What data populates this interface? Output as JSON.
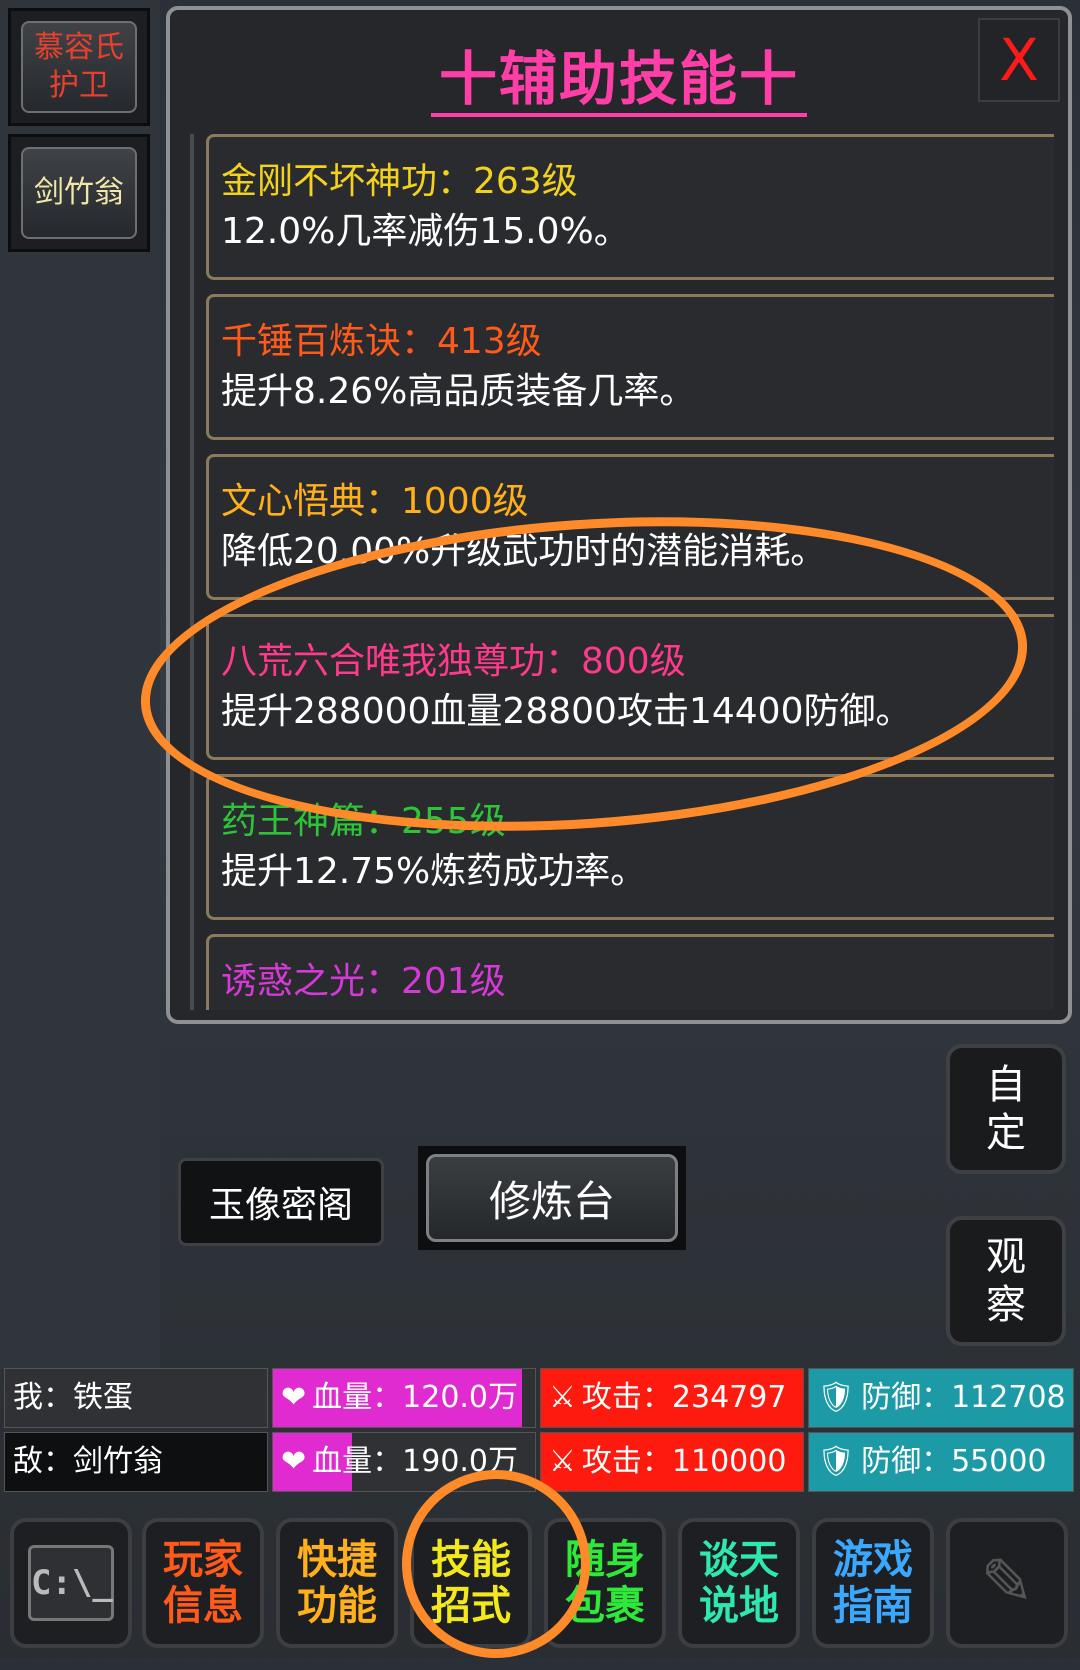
{
  "sidebar": {
    "tabs": [
      {
        "label": "慕容氏护卫"
      },
      {
        "label": "剑竹翁"
      }
    ]
  },
  "panel": {
    "title": "十辅助技能十",
    "close_label": "X",
    "skills": [
      {
        "name": "金刚不坏神功：263级",
        "desc": "12.0%几率减伤15.0%。",
        "color": "#f2d21c"
      },
      {
        "name": "千锤百炼诀：413级",
        "desc": "提升8.26%高品质装备几率。",
        "color": "#ff5a1a"
      },
      {
        "name": "文心悟典：1000级",
        "desc": "降低20.00%升级武功时的潜能消耗。",
        "color": "#ffb01a"
      },
      {
        "name": "八荒六合唯我独尊功：800级",
        "desc": "提升288000血量28800攻击14400防御。",
        "color": "#ff3a8c"
      },
      {
        "name": "药王神篇：255级",
        "desc": "提升12.75%炼药成功率。",
        "color": "#2ec43a"
      },
      {
        "name": "诱惑之光：201级",
        "desc": "",
        "color": "#d63ad6"
      }
    ]
  },
  "buttons": {
    "yuxiang": "玉像密阁",
    "xiulian": "修炼台",
    "custom": "自定",
    "observe": "观察"
  },
  "stats": {
    "me": {
      "name": "我：铁蛋",
      "hp": "血量：120.0万",
      "hp_fraction": 0.95,
      "atk": "攻击：234797",
      "def": "防御：112708"
    },
    "enemy": {
      "name": "敌：剑竹翁",
      "hp": "血量：190.0万",
      "hp_fraction": 0.3,
      "atk": "攻击：110000",
      "def": "防御：55000"
    }
  },
  "nav": {
    "console": "C:\\_",
    "items": [
      {
        "label": "玩家信息",
        "color": "#ff5a1a"
      },
      {
        "label": "快捷功能",
        "color": "#ffb01a"
      },
      {
        "label": "技能招式",
        "color": "#f2e81c"
      },
      {
        "label": "随身包裹",
        "color": "#2ee83a"
      },
      {
        "label": "谈天说地",
        "color": "#2ee8b0"
      },
      {
        "label": "游戏指南",
        "color": "#3aa8ff"
      }
    ],
    "pen_icon": "pen-icon"
  },
  "colors": {
    "annotation": "#ff8a2a"
  }
}
